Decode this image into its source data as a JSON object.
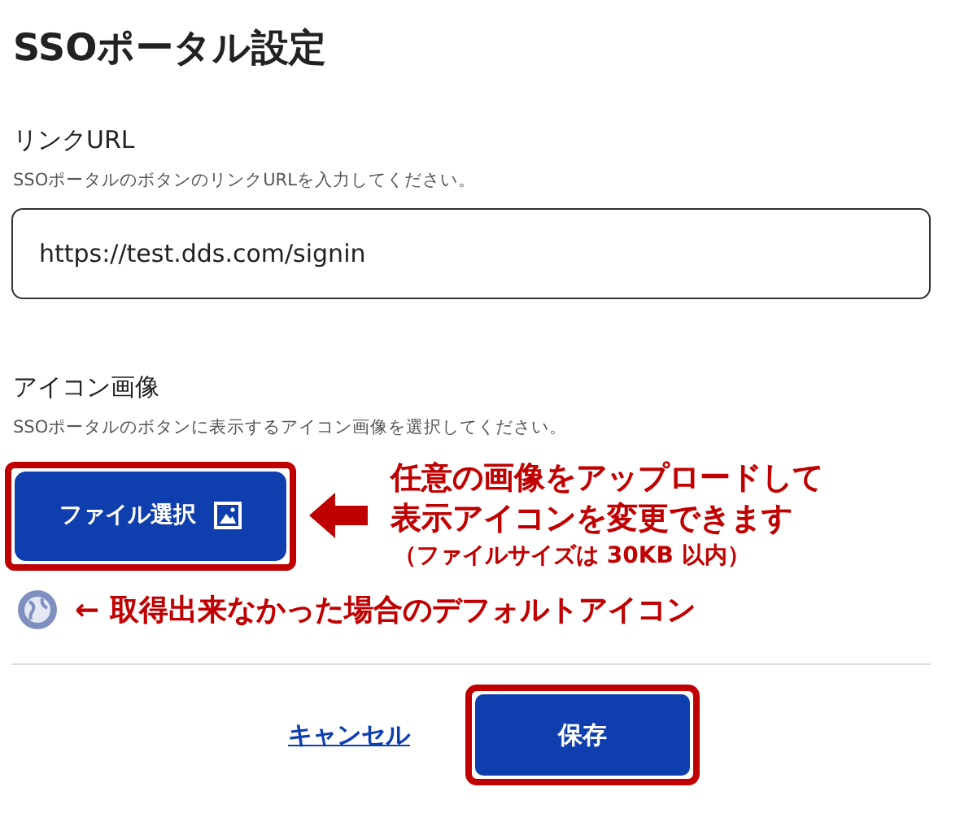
{
  "title": "SSOポータル設定",
  "link_url": {
    "label": "リンクURL",
    "hint": "SSOポータルのボタンのリンクURLを入力してください。",
    "value": "https://test.dds.com/signin"
  },
  "icon_image": {
    "label": "アイコン画像",
    "hint": "SSOポータルのボタンに表示するアイコン画像を選択してください。",
    "button_label": "ファイル選択"
  },
  "annotations": {
    "upload_note": [
      "任意の画像をアップロードして",
      "表示アイコンを変更できます"
    ],
    "size_note": "（ファイルサイズは 30KB 以内）",
    "default_icon_note": "← 取得出来なかった場合のデフォルトアイコン"
  },
  "actions": {
    "cancel": "キャンセル",
    "save": "保存"
  }
}
